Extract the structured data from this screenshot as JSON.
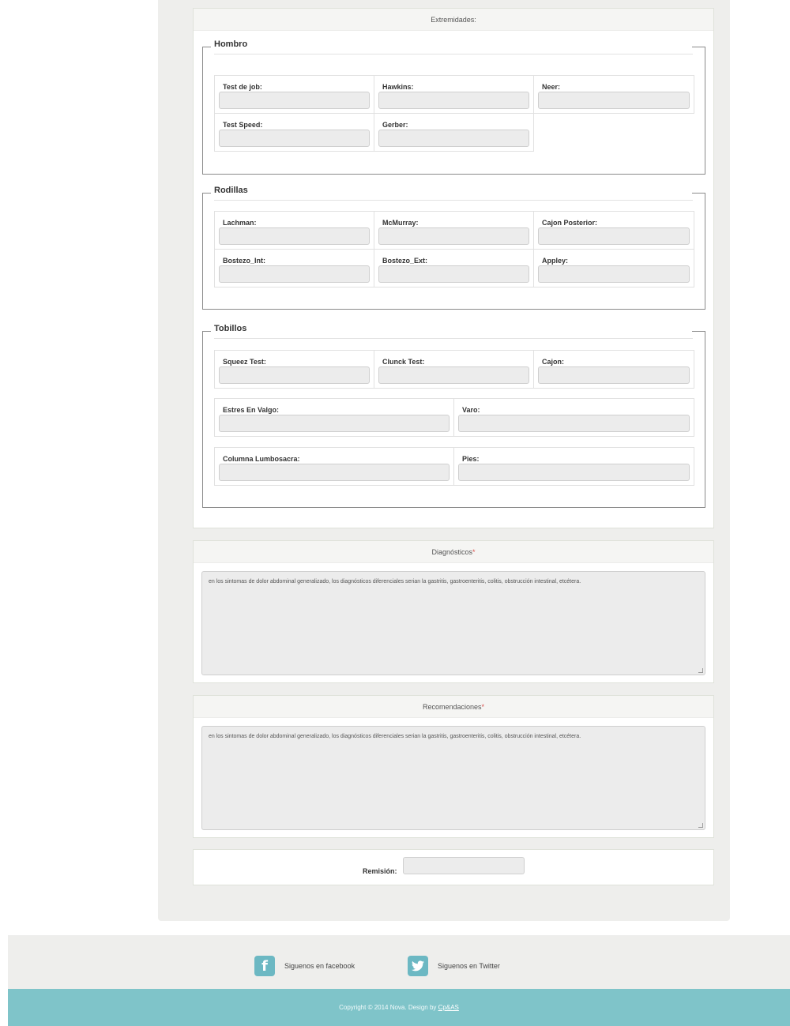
{
  "extremidades": {
    "title": "Extremidades:",
    "hombro": {
      "legend": "Hombro",
      "fields": [
        "Test de job:",
        "Hawkins:",
        "Neer:",
        "Test Speed:",
        "Gerber:"
      ]
    },
    "rodillas": {
      "legend": "Rodillas",
      "fields": [
        "Lachman:",
        "McMurray:",
        "Cajon Posterior:",
        "Bostezo_Int:",
        "Bostezo_Ext:",
        "Appley:"
      ]
    },
    "tobillos": {
      "legend": "Tobillos",
      "row1": [
        "Squeez Test:",
        "Clunck Test:",
        "Cajon:"
      ],
      "row2": [
        "Estres En Valgo:",
        "Varo:"
      ],
      "row3": [
        "Columna Lumbosacra:",
        "Pies:"
      ]
    }
  },
  "diagnosticos": {
    "title": "Diagnósticos",
    "required_mark": "*",
    "value": "en los sintomas de dolor abdominal generalizado, los diagnósticos diferenciales serian la gastritis, gastroenteritis, colitis, obstrucción intestinal, etcétera."
  },
  "recomendaciones": {
    "title": "Recomendaciones",
    "required_mark": "*",
    "value": "en los sintomas de dolor abdominal generalizado, los diagnósticos diferenciales serian la gastritis, gastroenteritis, colitis, obstrucción intestinal, etcétera."
  },
  "remision": {
    "label": "Remisión:",
    "value": ""
  },
  "footer": {
    "facebook": "Siguenos en facebook",
    "twitter": "Siguenos en Twitter",
    "copyright": "Copyright © 2014 Nova. Design by",
    "designer": "Cp&AS"
  },
  "colors": {
    "accent": "#7fc4c9",
    "icon": "#6cb8c3",
    "required": "#d9534f"
  }
}
